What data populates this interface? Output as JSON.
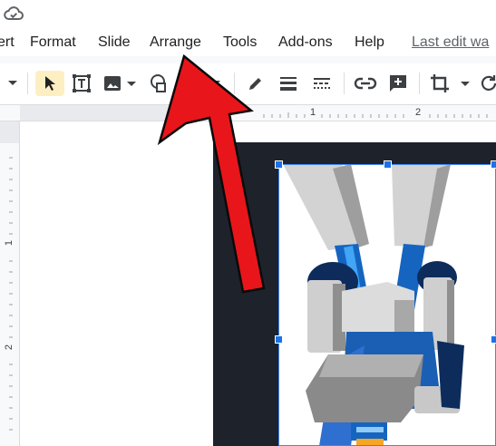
{
  "menubar": {
    "items": [
      "ert",
      "Format",
      "Slide",
      "Arrange",
      "Tools",
      "Add-ons",
      "Help"
    ],
    "last_edit": "Last edit wa"
  },
  "toolbar": {
    "icons": [
      "dropdown-arrow-icon",
      "select-cursor-icon",
      "text-box-icon",
      "image-icon",
      "shape-icon",
      "line-dropdown-icon",
      "pen-icon",
      "border-weight-icon",
      "border-dash-icon",
      "link-icon",
      "add-comment-icon",
      "crop-icon",
      "reset-image-icon"
    ],
    "active_tool": "select-cursor-icon"
  },
  "rulers": {
    "horizontal_labels": [
      "1",
      "2"
    ],
    "vertical_labels": [
      "1",
      "2"
    ]
  },
  "colors": {
    "accent": "#1a73e8",
    "active_tool_bg": "#feefc3",
    "slide_background": "#1e222b",
    "arrow": "#e8161a"
  },
  "annotation": {
    "arrow_points_to": "Arrange"
  }
}
